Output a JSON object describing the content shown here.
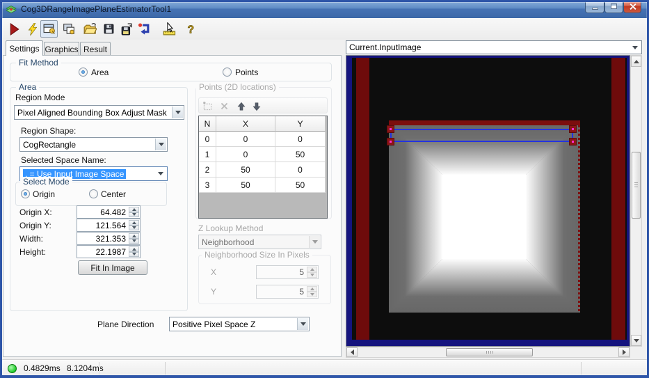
{
  "window": {
    "title": "Cog3DRangeImagePlaneEstimatorTool1",
    "controls": [
      "minimize-icon",
      "maximize-icon",
      "close-icon"
    ]
  },
  "toolbar": {
    "icons": [
      "run-icon",
      "electric-run-icon",
      "show-record-display-icon",
      "float-window-icon",
      "open-file-icon",
      "save-icon",
      "save-image-icon",
      "reset-icon",
      "electric-pointer-icon",
      "help-icon"
    ]
  },
  "tabs": [
    {
      "label": "Settings",
      "active": true
    },
    {
      "label": "Graphics",
      "active": false
    },
    {
      "label": "Result",
      "active": false
    }
  ],
  "fit_method": {
    "label": "Fit Method",
    "options": [
      {
        "label": "Area",
        "selected": true
      },
      {
        "label": "Points",
        "selected": false
      }
    ]
  },
  "area": {
    "label": "Area",
    "region_mode_label": "Region Mode",
    "region_mode_value": "Pixel Aligned Bounding Box Adjust Mask",
    "region_shape_label": "Region Shape:",
    "region_shape_value": "CogRectangle",
    "selected_space_label": "Selected Space Name:",
    "selected_space_value": ". = Use Input Image Space",
    "select_mode": {
      "label": "Select Mode",
      "options": [
        {
          "label": "Origin",
          "selected": true
        },
        {
          "label": "Center",
          "selected": false
        }
      ]
    },
    "fields": [
      {
        "label": "Origin X:",
        "value": "64.482"
      },
      {
        "label": "Origin Y:",
        "value": "121.564"
      },
      {
        "label": "Width:",
        "value": "321.353"
      },
      {
        "label": "Height:",
        "value": "22.1987"
      }
    ],
    "fit_in_image_label": "Fit In Image"
  },
  "points": {
    "label": "Points (2D locations)",
    "toolbar_icons": [
      "add-point-icon",
      "delete-point-icon",
      "move-up-icon",
      "move-down-icon"
    ],
    "table": {
      "columns": [
        "N",
        "X",
        "Y"
      ],
      "rows": [
        [
          "0",
          "0",
          "0"
        ],
        [
          "1",
          "0",
          "50"
        ],
        [
          "2",
          "50",
          "0"
        ],
        [
          "3",
          "50",
          "50"
        ]
      ]
    },
    "z_lookup_label": "Z Lookup Method",
    "z_lookup_value": "Neighborhood",
    "neighborhood": {
      "label": "Neighborhood Size In Pixels",
      "fields": [
        {
          "label": "X",
          "value": "5"
        },
        {
          "label": "Y",
          "value": "5"
        }
      ]
    }
  },
  "plane_direction": {
    "label": "Plane Direction",
    "value": "Positive Pixel Space Z"
  },
  "display": {
    "source_value": "Current.InputImage"
  },
  "status": {
    "time1": "0.4829ms",
    "time2": "8.1204ms"
  },
  "colors": {
    "titlebar_blue": "#5f8cc5",
    "window_border": "#2e55a8",
    "selection_highlight": "#3595ff",
    "view_background_navy": "#15147e",
    "image_stripe_red": "#6e0b0b",
    "region_overlay_blue": "#2433e0",
    "handle_red": "#8c1616",
    "handle_dot_magenta": "#ff2bd1",
    "led_green": "#1ccb26"
  }
}
